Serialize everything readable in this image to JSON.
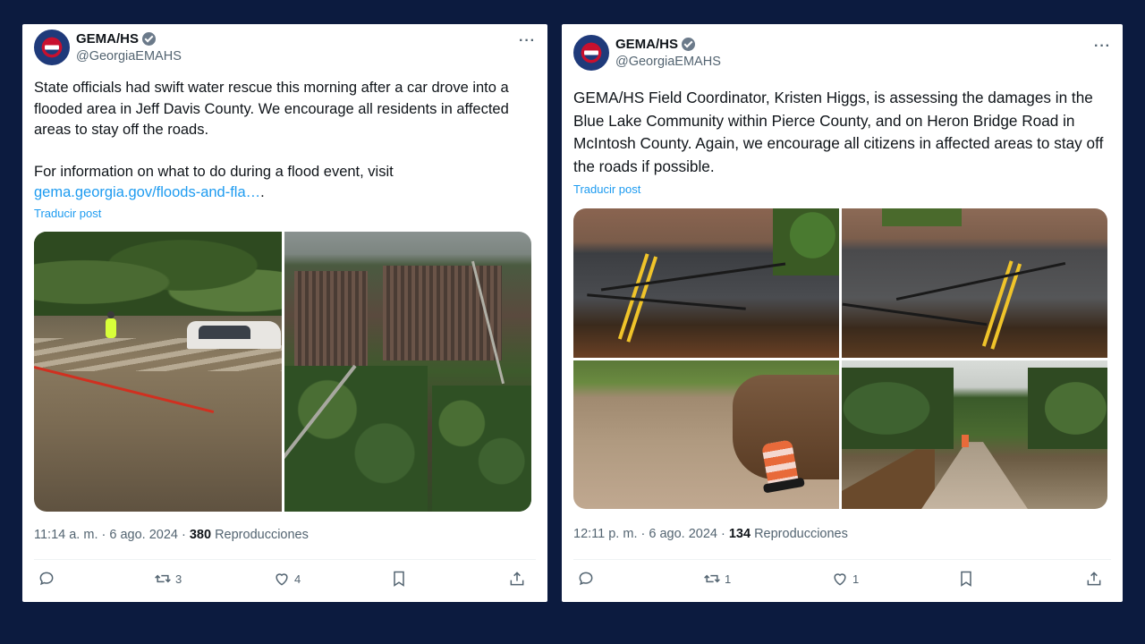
{
  "tweets": [
    {
      "account": {
        "name": "GEMA/HS",
        "handle": "@GeorgiaEMAHS"
      },
      "more": "···",
      "text": {
        "p1": "State officials had swift water rescue this morning after a car drove into a flooded area in Jeff Davis County. We encourage all residents in affected areas to stay off the roads.",
        "p2_prefix": "For information on what to do during a flood event, visit",
        "link": "gema.georgia.gov/floods-and-fla…",
        "p2_suffix": "."
      },
      "translate": "Traducir post",
      "meta": {
        "time": "11:14 a. m. · 6 ago. 2024 · ",
        "views": "380",
        "views_label": " Reproducciones"
      },
      "actions": {
        "replies": "",
        "reposts": "3",
        "likes": "4"
      }
    },
    {
      "account": {
        "name": "GEMA/HS",
        "handle": "@GeorgiaEMAHS"
      },
      "more": "···",
      "text": {
        "p1": "GEMA/HS Field Coordinator, Kristen Higgs, is assessing the damages in the Blue Lake Community within Pierce County, and on Heron Bridge Road in McIntosh County. Again, we encourage all citizens in affected areas to stay off the roads if possible."
      },
      "translate": "Traducir post",
      "meta": {
        "time": "12:11 p. m. · 6 ago. 2024 · ",
        "views": "134",
        "views_label": " Reproducciones"
      },
      "actions": {
        "replies": "",
        "reposts": "1",
        "likes": "1"
      }
    }
  ],
  "colors": {
    "background": "#0c1b3f",
    "link": "#1d9bf0",
    "muted": "#536471"
  },
  "icons": [
    "verified-badge-icon",
    "more-icon",
    "reply-icon",
    "repost-icon",
    "like-icon",
    "bookmark-icon",
    "share-icon"
  ]
}
